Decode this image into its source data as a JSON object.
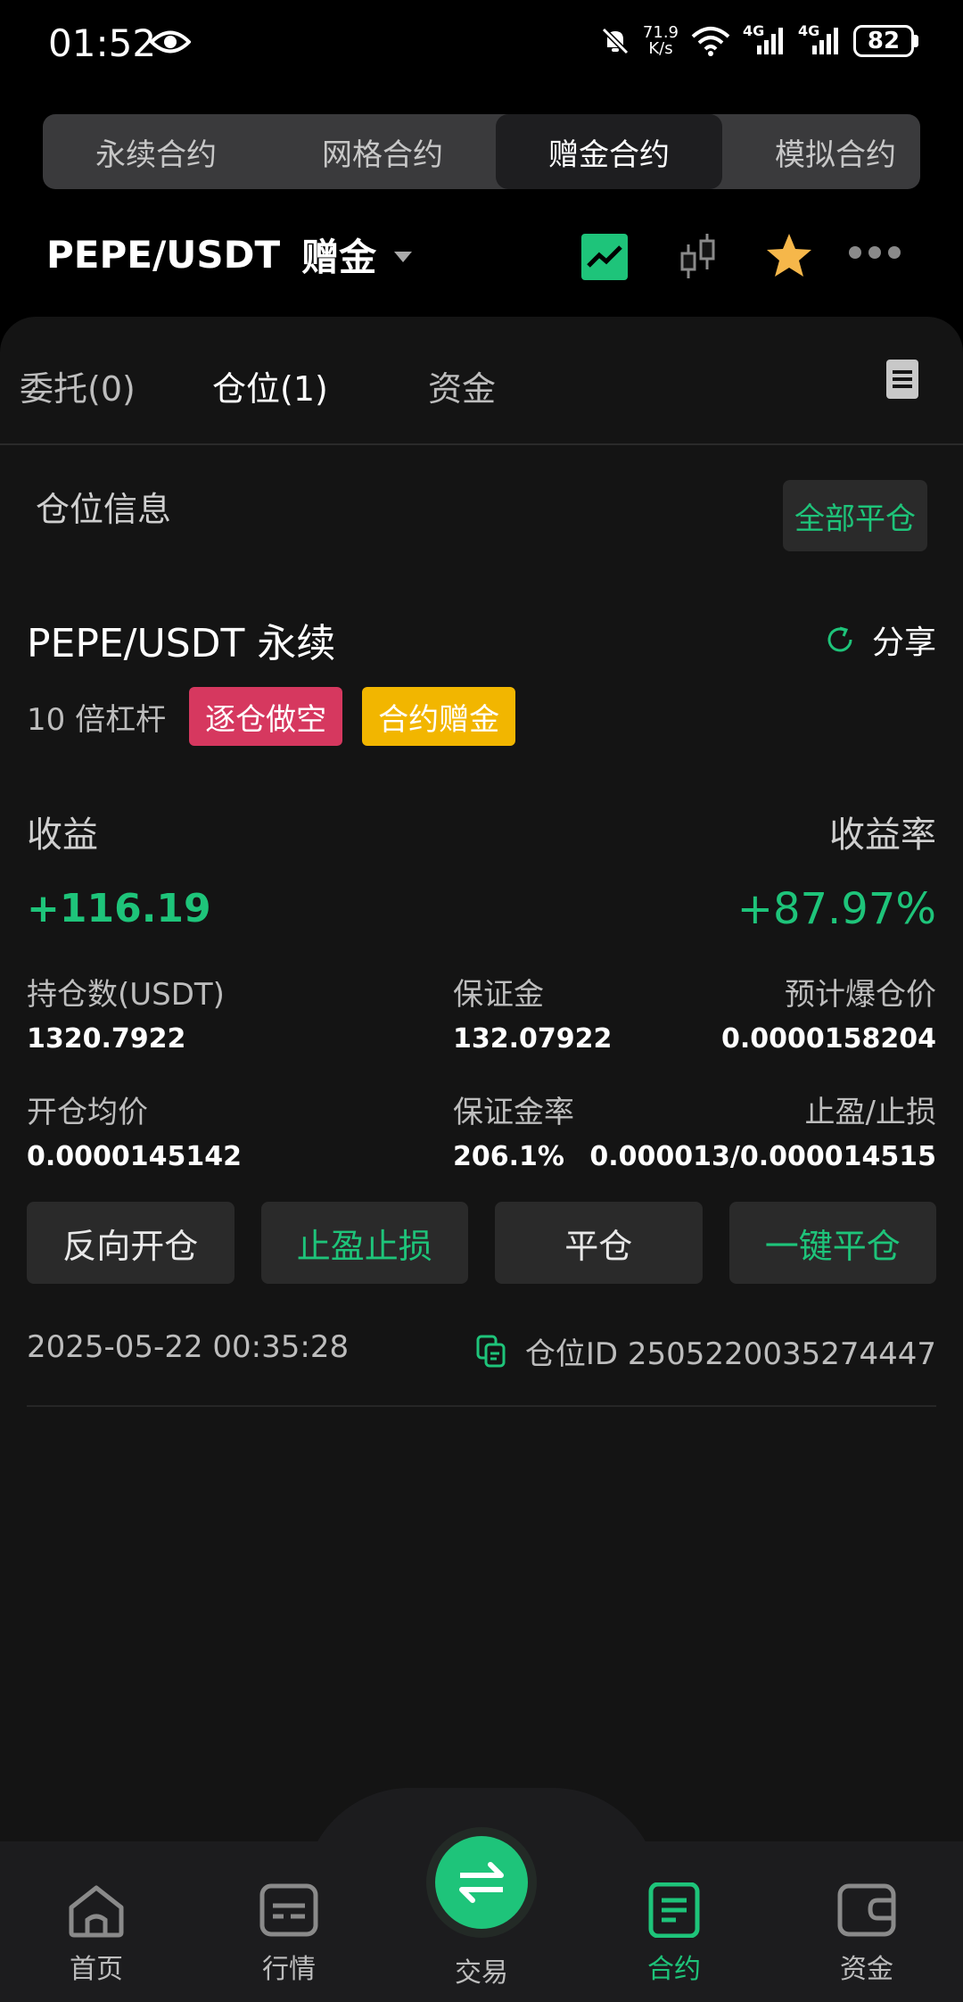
{
  "status_bar": {
    "time": "01:52",
    "net_speed_value": "71.9",
    "net_speed_unit": "K/s",
    "signal_1": "4G",
    "signal_2": "4G",
    "battery": "82"
  },
  "contract_tabs": [
    {
      "label": "永续合约"
    },
    {
      "label": "网格合约"
    },
    {
      "label": "赠金合约"
    },
    {
      "label": "模拟合约"
    }
  ],
  "header": {
    "pair": "PEPE/USDT",
    "badge": "赠金"
  },
  "panel_tabs": [
    {
      "label": "委托(0)"
    },
    {
      "label": "仓位(1)"
    },
    {
      "label": "资金"
    }
  ],
  "section": {
    "title": "仓位信息",
    "close_all": "全部平仓"
  },
  "position": {
    "title": "PEPE/USDT 永续",
    "share": "分享",
    "leverage": "10 倍杠杆",
    "tag_short": "逐仓做空",
    "tag_bonus": "合约赠金",
    "pnl_label": "收益",
    "roe_label": "收益率",
    "pnl_value": "+116.19",
    "roe_value": "+87.97%",
    "stats": {
      "size_label": "持仓数(USDT)",
      "size_value": "1320.7922",
      "margin_label": "保证金",
      "margin_value": "132.07922",
      "liq_label": "预计爆仓价",
      "liq_value": "0.0000158204",
      "entry_label": "开仓均价",
      "entry_value": "0.0000145142",
      "margin_rate_label": "保证金率",
      "margin_rate_value": "206.1%",
      "tpsl_label": "止盈/止损",
      "tpsl_value": "0.000013/0.000014515"
    },
    "actions": {
      "reverse": "反向开仓",
      "tpsl": "止盈止损",
      "close": "平仓",
      "one_click_close": "一键平仓"
    },
    "open_time": "2025-05-22 00:35:28",
    "position_id": "仓位ID 2505220035274447"
  },
  "bottom_nav": {
    "home": "首页",
    "market": "行情",
    "trade": "交易",
    "contract": "合约",
    "assets": "资金"
  },
  "colors": {
    "accent_green": "#1ec47a",
    "short_red": "#d6385f",
    "bonus_yellow": "#f2b600"
  }
}
